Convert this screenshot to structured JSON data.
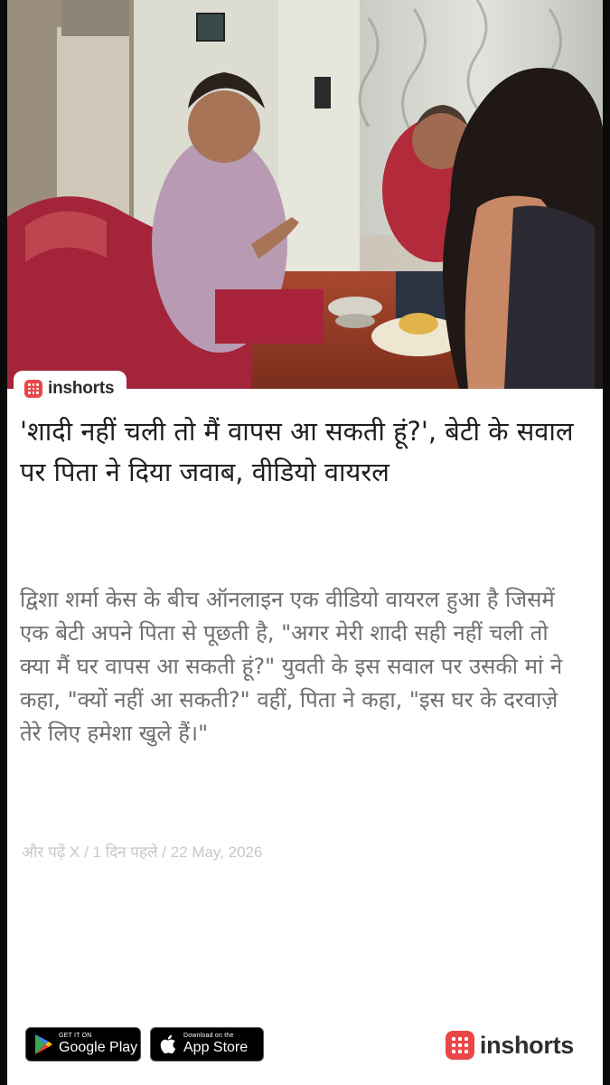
{
  "brand": {
    "name": "inshorts",
    "accent": "#e94748"
  },
  "article": {
    "headline": "'शादी नहीं चली तो मैं वापस आ सकती हूं?', बेटी के सवाल पर पिता ने दिया जवाब, वीडियो वायरल",
    "summary": "द्विशा शर्मा केस के बीच ऑनलाइन एक वीडियो वायरल हुआ है जिसमें एक बेटी अपने पिता से पूछती है, \"अगर मेरी शादी सही नहीं चली तो क्या मैं घर वापस आ सकती हूं?\" युवती के इस सवाल पर उसकी मां ने कहा, \"क्यों नहीं आ सकती?\" वहीं, पिता ने कहा, \"इस घर के दरवाज़े तेरे लिए हमेशा खुले हैं।\"",
    "read_more": "और पढ़ें X",
    "separator": " / ",
    "relative_time": "1 दिन पहले",
    "date": "22 May, 2026"
  },
  "stores": {
    "google_play": {
      "small": "GET IT ON",
      "big": "Google Play"
    },
    "app_store": {
      "small": "Download on the",
      "big": "App Store"
    }
  },
  "colors": {
    "headline": "#1e1e1e",
    "summary": "#6e6e6e",
    "meta": "#c7c7c7"
  }
}
